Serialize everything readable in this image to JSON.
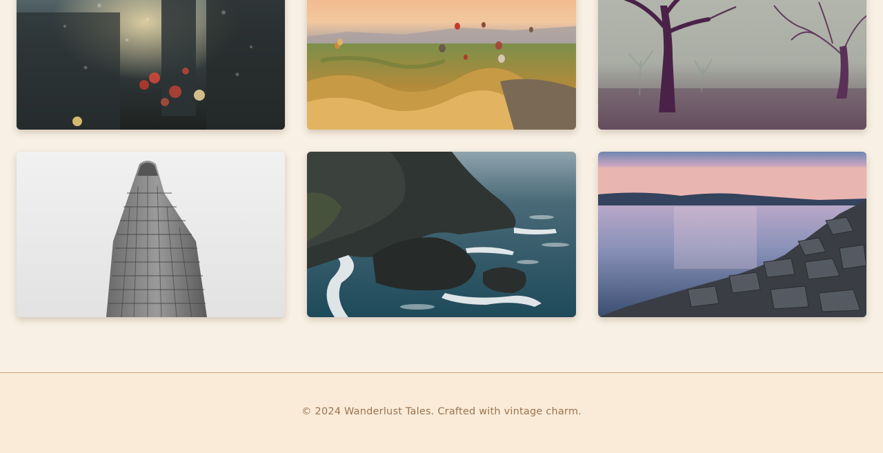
{
  "gallery": {
    "items": [
      {
        "scene": "rain-window-city-bokeh"
      },
      {
        "scene": "hot-air-balloons-valley"
      },
      {
        "scene": "misty-purple-trees"
      },
      {
        "scene": "flatiron-building"
      },
      {
        "scene": "rocky-sea-cliffs"
      },
      {
        "scene": "lake-sunset-rocks"
      }
    ]
  },
  "footer": {
    "copyright": "© 2024 Wanderlust Tales. Crafted with vintage charm."
  },
  "colors": {
    "background": "#f8f0e4",
    "footer_bg": "#f9ebd8",
    "footer_text": "#9a7350",
    "footer_border": "#c9a586"
  }
}
